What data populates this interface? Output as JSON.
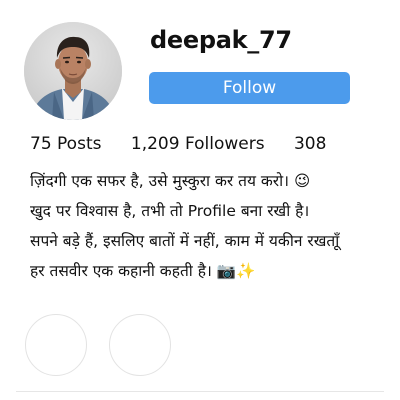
{
  "profile": {
    "username": "deepak_77",
    "follow_label": "Follow",
    "avatar_icon": "profile-photo"
  },
  "stats": {
    "posts": "75 Posts",
    "followers": "1,209 Followers",
    "following": "308"
  },
  "bio": {
    "lines": [
      "ज़िंदगी एक सफर है, उसे मुस्कुरा कर तय करो। 😉",
      "खुद पर विश्वास है, तभी तो Profile बना रखी है।",
      "सपने बड़े हैं, इसलिए बातों में नहीं, काम में यकीन रखताूँ",
      "हर तसवीर एक कहानी कहती है। 📷✨"
    ]
  },
  "colors": {
    "accent": "#4c9bec",
    "text": "#111111"
  }
}
